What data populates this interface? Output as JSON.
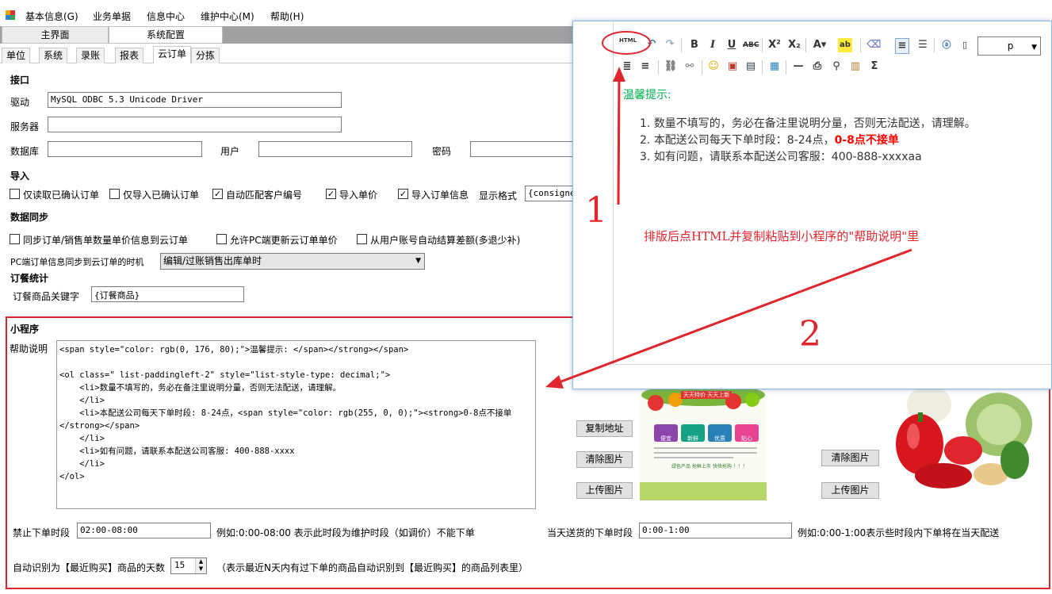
{
  "menu": {
    "items": [
      "基本信息(G)",
      "业务单据",
      "信息中心",
      "维护中心(M)",
      "帮助(H)"
    ]
  },
  "doc_tabs": [
    "主界面",
    "系统配置"
  ],
  "sub_tabs": [
    "单位",
    "系统",
    "录账",
    "报表",
    "云订单",
    "分拣"
  ],
  "interface": {
    "title": "接口",
    "driver_label": "驱动",
    "driver_value": "MySQL ODBC 5.3 Unicode Driver",
    "server_label": "服务器",
    "server_value": "",
    "database_label": "数据库",
    "database_value": "",
    "user_label": "用户",
    "user_value": "",
    "password_label": "密码",
    "password_value": ""
  },
  "import": {
    "title": "导入",
    "options": [
      {
        "label": "仅读取已确认订单",
        "checked": false
      },
      {
        "label": "仅导入已确认订单",
        "checked": false
      },
      {
        "label": "自动匹配客户编号",
        "checked": true
      },
      {
        "label": "导入单价",
        "checked": true
      },
      {
        "label": "导入订单信息",
        "checked": true
      }
    ],
    "display_format_label": "显示格式",
    "display_format_value": "{consignee"
  },
  "sync": {
    "title": "数据同步",
    "options": [
      {
        "label": "同步订单/销售单数量单价信息到云订单",
        "checked": false
      },
      {
        "label": "允许PC端更新云订单单价",
        "checked": false
      },
      {
        "label": "从用户账号自动结算差额(多退少补)",
        "checked": false
      }
    ],
    "timing_label": "PC端订单信息同步到云订单的时机",
    "timing_value": "编辑/过账销售出库单时"
  },
  "meal": {
    "title": "订餐统计",
    "keyword_label": "订餐商品关键字",
    "keyword_value": "{订餐商品}"
  },
  "mini": {
    "title": "小程序",
    "help_label": "帮助说明",
    "help_html": "<span style=\"color: rgb(0, 176, 80);\">温馨提示: </span></strong></span>\n\n<ol class=\" list-paddingleft-2\" style=\"list-style-type: decimal;\">\n    <li>数量不填写的，务必在备注里说明分量，否则无法配送，请理解。\n    </li>\n    <li>本配送公司每天下单时段: 8-24点，<span style=\"color: rgb(255, 0, 0);\"><strong>0-8点不接单\n</strong></span>\n    </li>\n    <li>如有问题，请联系本配送公司客服: 400-888-xxxx\n    </li>\n</ol>",
    "copy_addr": "复制地址",
    "clear_img": "清除图片",
    "upload_img": "上传图片",
    "forbid_label": "禁止下单时段",
    "forbid_value": "02:00-08:00",
    "forbid_hint": "例如:0:00-08:00 表示此时段为维护时段（如调价）不能下单",
    "sameday_label": "当天送货的下单时段",
    "sameday_value": "0:00-1:00",
    "sameday_hint": "例如:0:00-1:00表示些时段内下单将在当天配送",
    "recent_label": "自动识别为【最近购买】商品的天数",
    "recent_days": "15",
    "recent_hint": "（表示最近N天内有过下单的商品自动识别到【最近购买】的商品列表里）"
  },
  "promo": {
    "banner_top": "天天特价  天天上新",
    "badges": [
      "便宜",
      "新鲜",
      "优质",
      "贴心"
    ],
    "line1": "绿色产品   抢鲜上市   快快抢购 ！！！"
  },
  "editor": {
    "html_btn": "HTML",
    "paragraph_value": "p",
    "tip": "温馨提示:",
    "items": [
      "数量不填写的，务必在备注里说明分量，否则无法配送，请理解。",
      "本配送公司每天下单时段：8-24点，",
      "如有问题，请联系本配送公司客服：400-888-xxxxaa"
    ],
    "item2_red": "0-8点不接单"
  },
  "annotations": {
    "step1": "1",
    "step2": "2",
    "note": "排版后点HTML并复制粘贴到小程序的\"帮助说明\"里"
  },
  "colors": {
    "green": "#00b050",
    "red": "#ff0000",
    "annot_red": "#e0252d"
  }
}
